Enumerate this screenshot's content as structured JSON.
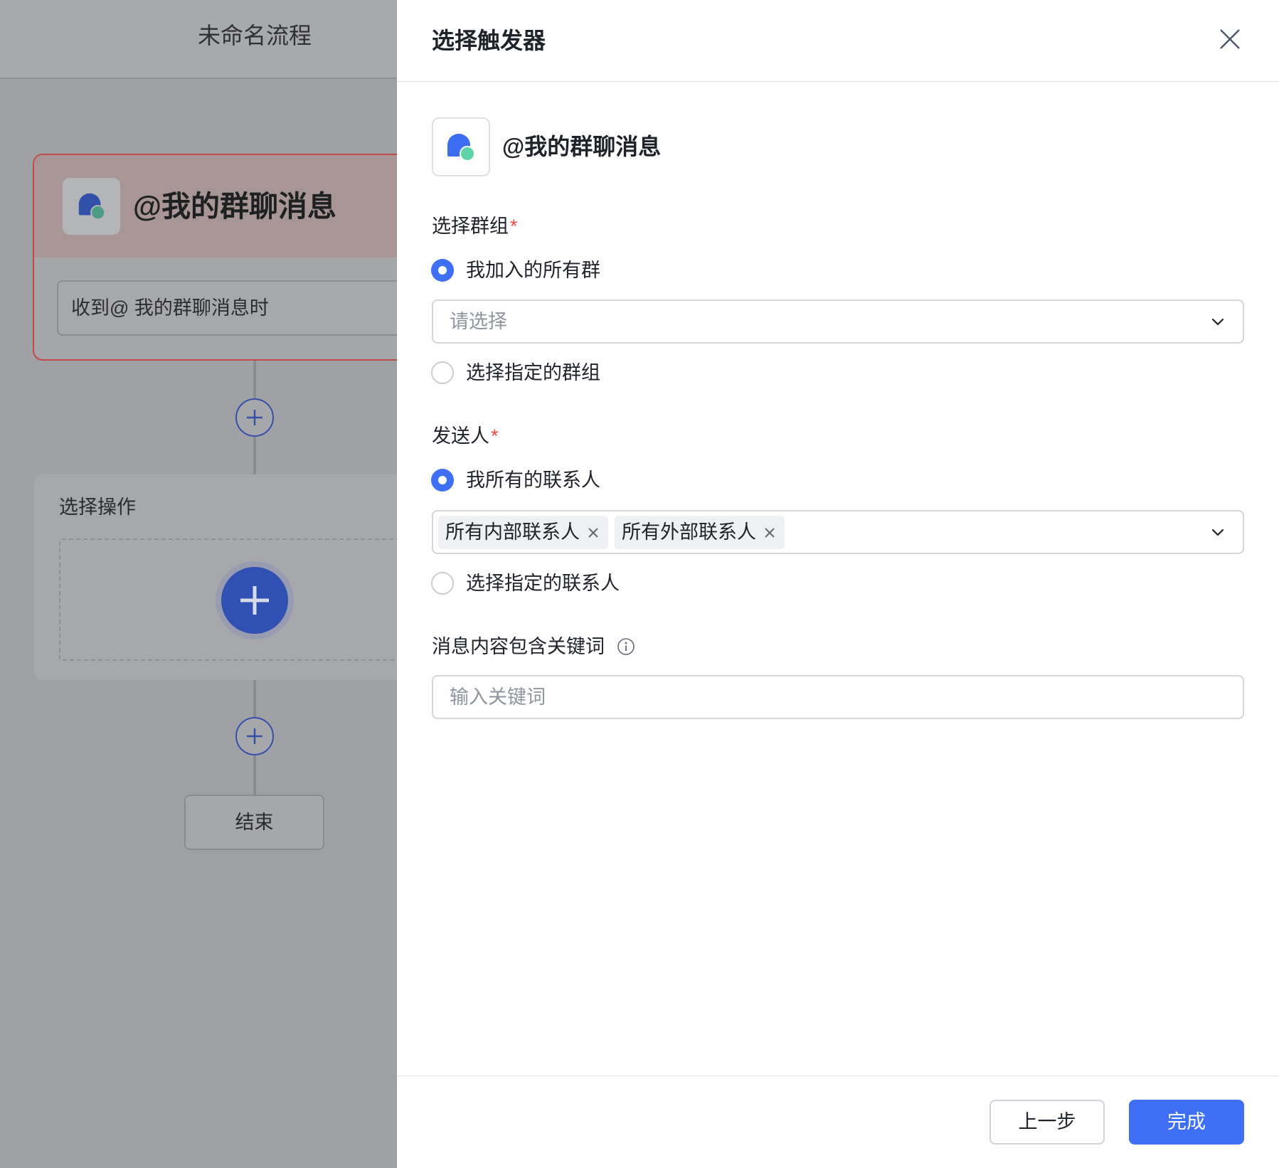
{
  "colors": {
    "accent": "#3e6ff5",
    "required": "#f54a45",
    "trigger_card_border": "#c24a4b"
  },
  "flow": {
    "header": {
      "title": "未命名流程"
    },
    "trigger_card": {
      "icon": "chat-bubbles-icon",
      "title": "@我的群聊消息",
      "summary": "收到@ 我的群聊消息时"
    },
    "add_buttons": [
      {
        "icon": "plus-icon"
      },
      {
        "icon": "plus-icon"
      }
    ],
    "action_card": {
      "label": "选择操作",
      "add_icon": "plus-icon"
    },
    "end_node": {
      "label": "结束"
    }
  },
  "drawer": {
    "title": "选择触发器",
    "close_icon": "close-icon",
    "trigger": {
      "icon": "chat-bubbles-icon",
      "name": "@我的群聊消息"
    },
    "group_field": {
      "label": "选择群组",
      "required_mark": "*",
      "options": [
        {
          "label": "我加入的所有群",
          "selected": true
        },
        {
          "label": "选择指定的群组",
          "selected": false
        }
      ],
      "select": {
        "placeholder": "请选择",
        "icon": "chevron-down-icon"
      }
    },
    "sender_field": {
      "label": "发送人",
      "required_mark": "*",
      "options": [
        {
          "label": "我所有的联系人",
          "selected": true
        },
        {
          "label": "选择指定的联系人",
          "selected": false
        }
      ],
      "select": {
        "tags": [
          {
            "label": "所有内部联系人",
            "remove_icon": "close-icon"
          },
          {
            "label": "所有外部联系人",
            "remove_icon": "close-icon"
          }
        ],
        "icon": "chevron-down-icon"
      }
    },
    "keyword_field": {
      "label": "消息内容包含关键词",
      "info_icon": "info-icon",
      "input": {
        "value": "",
        "placeholder": "输入关键词"
      }
    },
    "footer": {
      "prev_label": "上一步",
      "done_label": "完成"
    }
  }
}
